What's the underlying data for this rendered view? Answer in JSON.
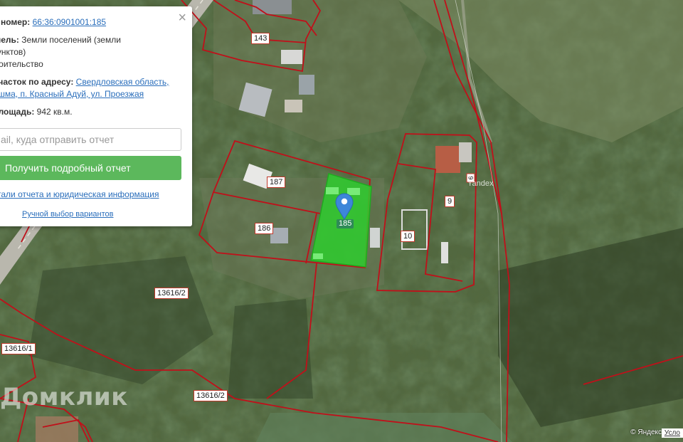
{
  "map": {
    "parcels": [
      {
        "id": "143",
        "text": "143"
      },
      {
        "id": "187",
        "text": "187"
      },
      {
        "id": "186",
        "text": "186"
      },
      {
        "id": "185",
        "text": "185"
      },
      {
        "id": "10",
        "text": "10"
      },
      {
        "id": "9",
        "text": "9"
      },
      {
        "id": "9b",
        "text": "9"
      },
      {
        "id": "13616_2a",
        "text": "13616/2"
      },
      {
        "id": "13616_1",
        "text": "13616/1"
      },
      {
        "id": "13616_2b",
        "text": "13616/2"
      }
    ],
    "yandex_inner": "Yandex",
    "watermark": "Домклик",
    "copyright": "© Яндекс",
    "terms": "Усло",
    "colors": {
      "boundary": "#c0101a",
      "selected": "#33cc33"
    }
  },
  "popup": {
    "cadastral_label": "ый номер:",
    "cadastral_value": "66:36:0901001:185",
    "category_label": "земель:",
    "category_value_1": "Земли поселений (земли",
    "category_value_2": "х пунктов)",
    "category_value_3": "строительство",
    "address_label": "й участок по адресу:",
    "address_value_1": "Свердловская область,",
    "address_value_2": "Пышма, п. Красный Адуй, ул. Проезжая",
    "area_label": "я площадь:",
    "area_value": "942 кв.м.",
    "email_placeholder": "ail, куда отправить отчет",
    "report_button": "Получить подробный отчет",
    "details_link": "тали отчета и юридическая информация",
    "manual_link": "Ручной выбор вариантов",
    "close_icon": "×"
  }
}
